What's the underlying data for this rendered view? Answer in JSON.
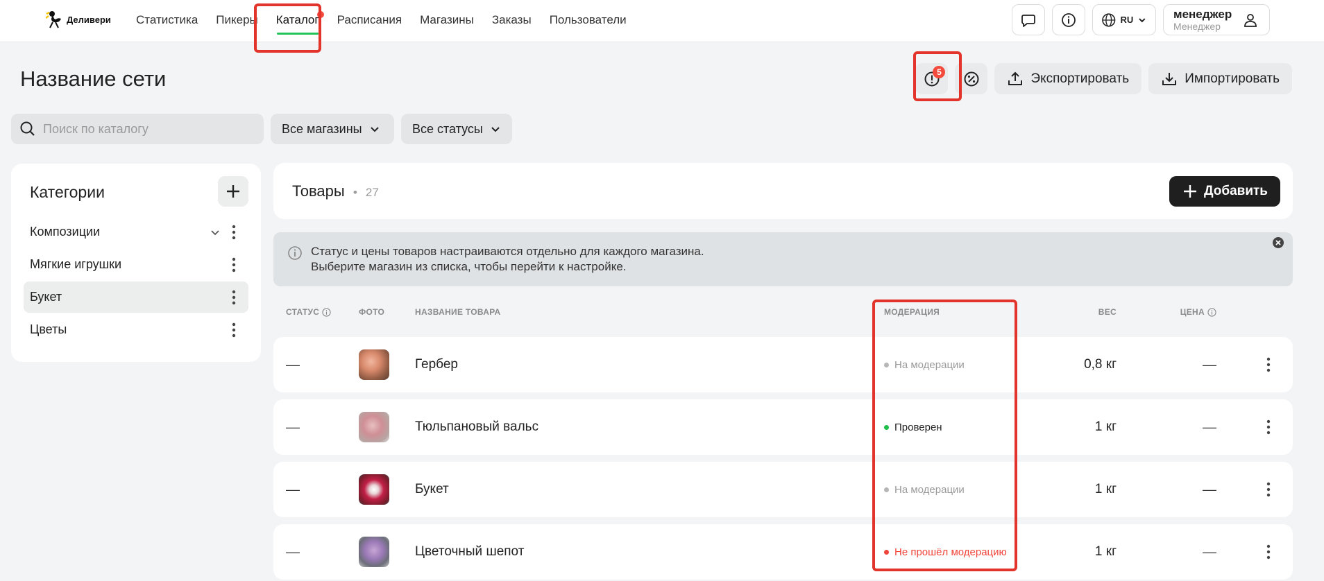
{
  "brand": {
    "name": "Деливери"
  },
  "nav": {
    "items": [
      {
        "label": "Статистика",
        "active": false
      },
      {
        "label": "Пикеры",
        "active": false
      },
      {
        "label": "Каталог",
        "active": true,
        "dot": true
      },
      {
        "label": "Расписания",
        "active": false
      },
      {
        "label": "Магазины",
        "active": false
      },
      {
        "label": "Заказы",
        "active": false
      },
      {
        "label": "Пользователи",
        "active": false
      }
    ]
  },
  "header": {
    "lang": "RU",
    "user_name": "менеджер",
    "user_role": "Менеджер"
  },
  "page": {
    "title": "Название сети",
    "alerts_count": "5",
    "export_label": "Экспортировать",
    "import_label": "Импортировать"
  },
  "filters": {
    "search_placeholder": "Поиск по каталогу",
    "search_value": "",
    "stores": "Все магазины",
    "statuses": "Все статусы"
  },
  "categories": {
    "title": "Категории",
    "items": [
      {
        "label": "Композиции",
        "expandable": true,
        "selected": false
      },
      {
        "label": "Мягкие игрушки",
        "expandable": false,
        "selected": false
      },
      {
        "label": "Букет",
        "expandable": false,
        "selected": true
      },
      {
        "label": "Цветы",
        "expandable": false,
        "selected": false
      }
    ]
  },
  "goods": {
    "title": "Товары",
    "separator": "•",
    "count": "27",
    "add_label": "Добавить"
  },
  "info": {
    "line1": "Статус и цены товаров настраиваются отдельно для каждого магазина.",
    "line2": "Выберите магазин из списка, чтобы перейти к настройке."
  },
  "table": {
    "columns": {
      "status": "СТАТУС",
      "photo": "ФОТО",
      "name": "НАЗВАНИЕ ТОВАРА",
      "moderation": "МОДЕРАЦИЯ",
      "weight": "ВЕС",
      "price": "ЦЕНА"
    },
    "rows": [
      {
        "status": "––",
        "name": "Гербер",
        "moderation": "На модерации",
        "mod_state": "pending",
        "weight": "0,8 кг",
        "price": "––"
      },
      {
        "status": "––",
        "name": "Тюльпановый вальс",
        "moderation": "Проверен",
        "mod_state": "ok",
        "weight": "1 кг",
        "price": "––"
      },
      {
        "status": "––",
        "name": "Букет",
        "moderation": "На модерации",
        "mod_state": "pending",
        "weight": "1 кг",
        "price": "––"
      },
      {
        "status": "––",
        "name": "Цветочный шепот",
        "moderation": "Не прошёл модерацию",
        "mod_state": "failed",
        "weight": "1 кг",
        "price": "––"
      }
    ]
  },
  "colors": {
    "accent_green": "#21c35a",
    "alert_red": "#f34a3d",
    "moderation_pending": "#9a9a9a",
    "moderation_ok": "#1fbf4a",
    "moderation_failed": "#f0433a",
    "annotation_box": "#e2342b"
  }
}
